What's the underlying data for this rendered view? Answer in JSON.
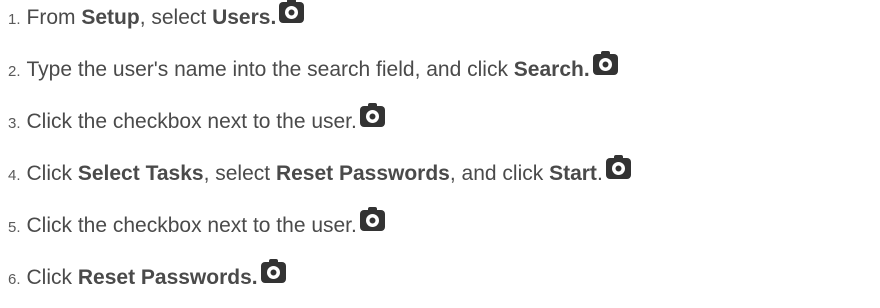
{
  "steps": [
    {
      "number": "1.",
      "parts": [
        "From ",
        "Setup",
        ", select ",
        "Users."
      ],
      "icon": "camera-icon"
    },
    {
      "number": "2.",
      "parts": [
        "Type the user's name into the search field, and click ",
        "Search."
      ],
      "icon": "camera-icon"
    },
    {
      "number": "3.",
      "parts": [
        "Click the checkbox next to the user."
      ],
      "icon": "camera-icon"
    },
    {
      "number": "4.",
      "parts": [
        "Click ",
        "Select Tasks",
        ", select ",
        "Reset Passwords",
        ", and click ",
        "Start",
        "."
      ],
      "icon": "camera-icon"
    },
    {
      "number": "5.",
      "parts": [
        "Click the checkbox next to the user."
      ],
      "icon": "camera-icon"
    },
    {
      "number": "6.",
      "parts": [
        "Click ",
        "Reset Passwords."
      ],
      "icon": "camera-icon"
    }
  ]
}
